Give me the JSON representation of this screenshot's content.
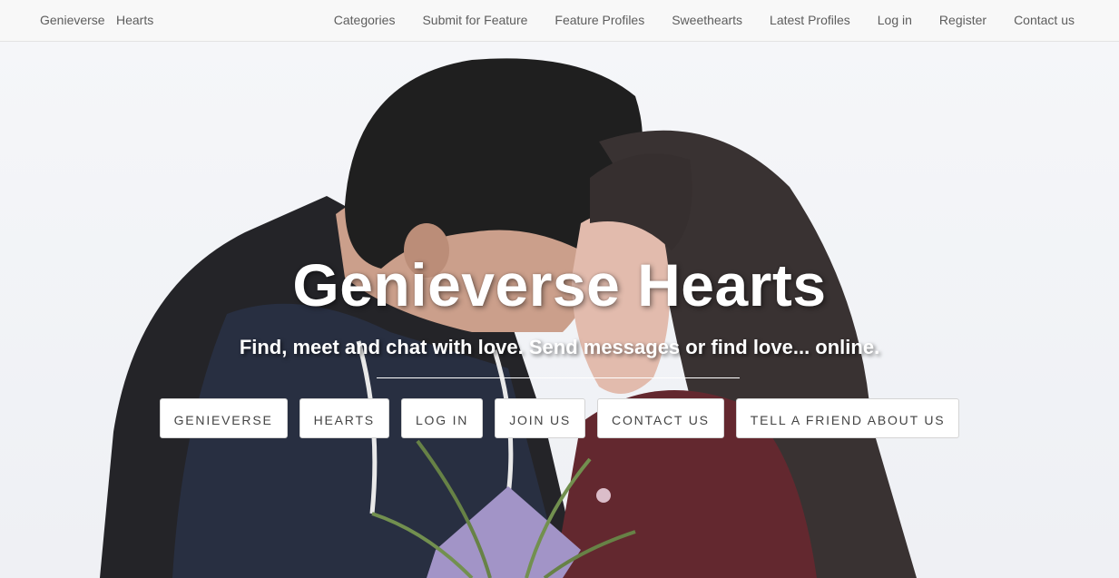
{
  "navbar": {
    "brand_parts": [
      "Genieverse",
      "Hearts"
    ],
    "links": [
      "Categories",
      "Submit for Feature",
      "Feature Profiles",
      "Sweethearts",
      "Latest Profiles",
      "Log in",
      "Register",
      "Contact us"
    ]
  },
  "hero": {
    "title": "Genieverse Hearts",
    "subtitle": "Find, meet and chat with love. Send messages or find love... online.",
    "buttons": [
      "GENIEVERSE",
      "HEARTS",
      "LOG IN",
      "JOIN US",
      "CONTACT US",
      "TELL A FRIEND ABOUT US"
    ]
  },
  "colors": {
    "nav_bg": "#f8f8f8",
    "nav_text": "#5d5d5d",
    "hero_text": "#ffffff",
    "button_bg": "#ffffff",
    "button_text": "#444444"
  }
}
